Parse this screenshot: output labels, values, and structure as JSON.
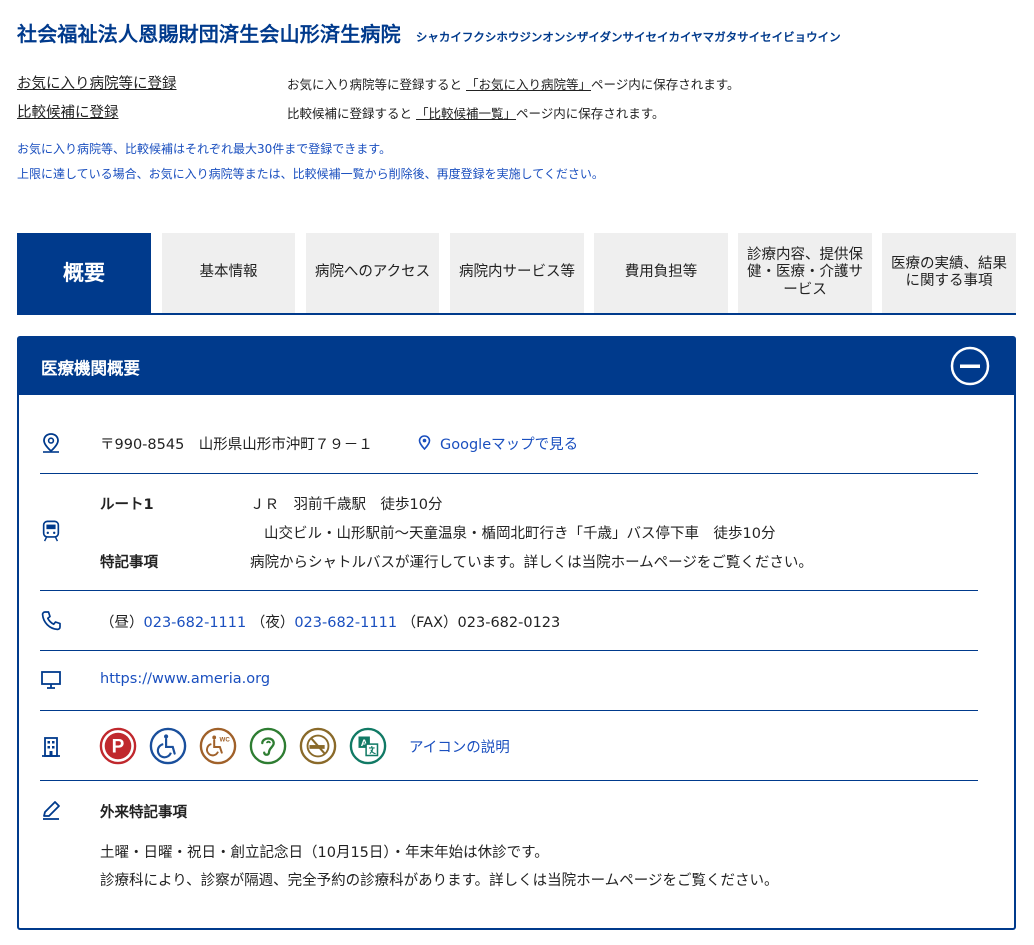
{
  "header": {
    "title": "社会福祉法人恩賜財団済生会山形済生病院",
    "kana": "シャカイフクシホウジンオンシザイダンサイセイカイヤマガタサイセイビョウイン"
  },
  "register": {
    "favorite_link": "お気に入り病院等に登録",
    "favorite_desc_pre": "お気に入り病院等に登録すると",
    "favorite_desc_page": "「お気に入り病院等」",
    "favorite_desc_post": "ページ内に保存されます。",
    "compare_link": "比較候補に登録",
    "compare_desc_pre": "比較候補に登録すると",
    "compare_desc_page": "「比較候補一覧」",
    "compare_desc_post": "ページ内に保存されます。",
    "note1": "お気に入り病院等、比較候補はそれぞれ最大30件まで登録できます。",
    "note2": "上限に達している場合、お気に入り病院等または、比較候補一覧から削除後、再度登録を実施してください。"
  },
  "tabs": [
    {
      "label": "概要"
    },
    {
      "label": "基本情報"
    },
    {
      "label": "病院へのアクセス"
    },
    {
      "label": "病院内サービス等"
    },
    {
      "label": "費用負担等"
    },
    {
      "label": "診療内容、提供保健・医療・介護サービス"
    },
    {
      "label": "医療の実績、結果に関する事項"
    }
  ],
  "panel": {
    "title": "医療機関概要",
    "address": "〒990-8545　山形県山形市沖町７９－１",
    "map_link": "Googleマップで見る",
    "route_label": "ルート1",
    "route_line1": "ＪＲ　羽前千歳駅　徒歩10分",
    "route_line2": "山交ビル・山形駅前～天童温泉・楯岡北町行き「千歳」バス停下車　徒歩10分",
    "special_label": "特記事項",
    "special_text": "病院からシャトルバスが運行しています。詳しくは当院ホームページをご覧ください。",
    "phone_day_label": "（昼）",
    "phone_day": "023-682-1111",
    "phone_night_label": "（夜）",
    "phone_night": "023-682-1111",
    "fax_label": "（FAX）",
    "fax": "023-682-0123",
    "url": "https://www.ameria.org",
    "icon_help": "アイコンの説明",
    "outpatient_title": "外来特記事項",
    "outpatient_line1": "土曜・日曜・祝日・創立記念日（10月15日）・年末年始は休診です。",
    "outpatient_line2": "診療科により、診察が隔週、完全予約の診療科があります。詳しくは当院ホームページをご覧ください。"
  },
  "facility_icons": [
    {
      "name": "parking-icon",
      "glyph": "P",
      "color": "#c0282d"
    },
    {
      "name": "wheelchair-icon",
      "color": "#1a4f9c"
    },
    {
      "name": "accessible-toilet-icon",
      "glyph": "WC",
      "color": "#a0612a"
    },
    {
      "name": "hearing-assist-icon",
      "color": "#2e7d32"
    },
    {
      "name": "no-smoking-icon",
      "color": "#8a6a2a"
    },
    {
      "name": "translation-icon",
      "glyph": "A",
      "color": "#117a65"
    }
  ],
  "colors": {
    "brand": "#003a8c",
    "link": "#1a4fbf",
    "tab_bg": "#efefef"
  }
}
